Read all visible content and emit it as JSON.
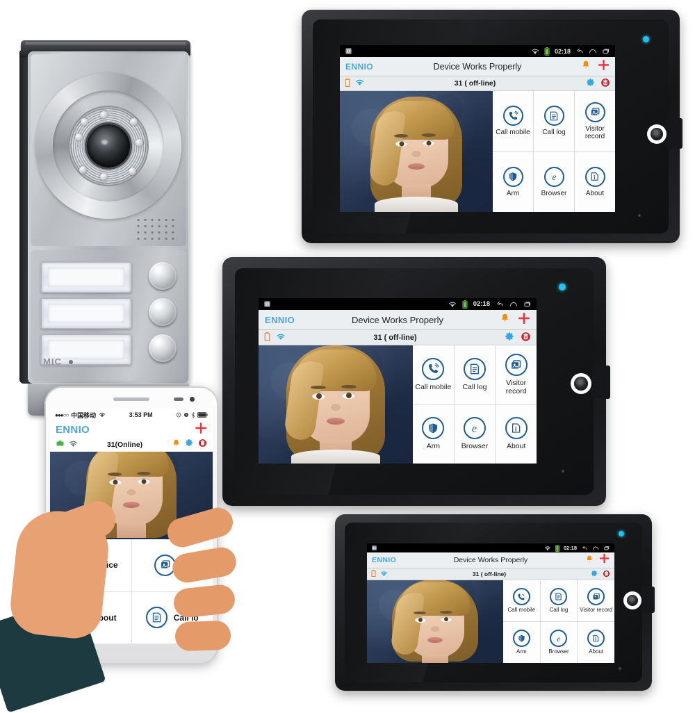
{
  "product": {
    "brand": "ENNIO",
    "scene_description": "Video door phone intercom kit: one outdoor camera door station, three indoor monitors and a smartphone app"
  },
  "door_station": {
    "mic_label": "MIC",
    "button_count": 3,
    "icons": {
      "camera": "camera-lens-icon",
      "speaker": "speaker-grille-icon",
      "mic": "microphone-icon",
      "visor": "rain-visor"
    }
  },
  "monitor_ui": {
    "system_bar": {
      "app_icon": "app-notification-icon",
      "wifi_icon": "wifi-icon",
      "battery_icon": "battery-icon",
      "time": "02:18",
      "nav": [
        "back-icon",
        "home-icon",
        "recents-icon"
      ]
    },
    "app_bar": {
      "brand": "ENNIO",
      "title": "Device Works Properly",
      "actions": [
        {
          "name": "bell-icon",
          "label": "Alarm"
        },
        {
          "name": "plus-icon",
          "label": "Add"
        }
      ]
    },
    "status_row": {
      "battery_icon": "battery-icon",
      "wifi_icon": "wifi-icon",
      "device_status": "31 ( off-line)",
      "actions": [
        {
          "name": "gear-icon",
          "label": "Settings"
        },
        {
          "name": "trash-icon",
          "label": "Delete"
        }
      ]
    },
    "video": {
      "label": "live-video-feed",
      "background_color": "#2b3b58"
    },
    "tiles": [
      {
        "icon": "call-mobile-icon",
        "label": "Call mobile"
      },
      {
        "icon": "call-log-icon",
        "label": "Call log"
      },
      {
        "icon": "visitor-record-icon",
        "label": "Visitor record"
      },
      {
        "icon": "arm-shield-icon",
        "label": "Arm"
      },
      {
        "icon": "browser-icon",
        "label": "Browser"
      },
      {
        "icon": "about-info-icon",
        "label": "About"
      }
    ]
  },
  "phone_ui": {
    "status": {
      "signal": "●●●○○",
      "carrier": "中国移动",
      "wifi_icon": "wifi-icon",
      "time": "3:53 PM",
      "right_icons": [
        "rotation-lock-icon",
        "alarm-icon",
        "bluetooth-icon",
        "battery-icon"
      ]
    },
    "app_bar": {
      "brand": "ENNIO",
      "action": {
        "name": "plus-icon",
        "label": "Add"
      }
    },
    "status_row": {
      "device_icon": "device-icon",
      "wifi_icon": "wifi-icon",
      "device_status": "31(Online)",
      "actions": [
        {
          "name": "bell-icon",
          "label": "Alarm"
        },
        {
          "name": "gear-icon",
          "label": "Settings"
        },
        {
          "name": "trash-icon",
          "label": "Delete"
        }
      ]
    },
    "tiles": [
      {
        "icon": "device-call-icon",
        "label": "Device"
      },
      {
        "icon": "visitor-record-icon",
        "label": "Vi"
      },
      {
        "icon": "about-info-icon",
        "label": "About"
      },
      {
        "icon": "call-log-icon",
        "label": "Call lo"
      }
    ]
  },
  "colors": {
    "brand_blue": "#4aa7e0",
    "icon_blue": "#1f5c96",
    "accent_red": "#e8333a",
    "bell_orange": "#f29100",
    "led_cyan": "#1fc3ef",
    "appbar_bg": "#eceff1",
    "video_navy": "#2b3b58",
    "skin": "#e8a173",
    "sleeve": "#1d3a40"
  },
  "monitors": [
    {
      "id": "monitor-top-right",
      "position": "top-right"
    },
    {
      "id": "monitor-middle",
      "position": "middle"
    },
    {
      "id": "monitor-bottom-right",
      "position": "bottom-right"
    }
  ]
}
